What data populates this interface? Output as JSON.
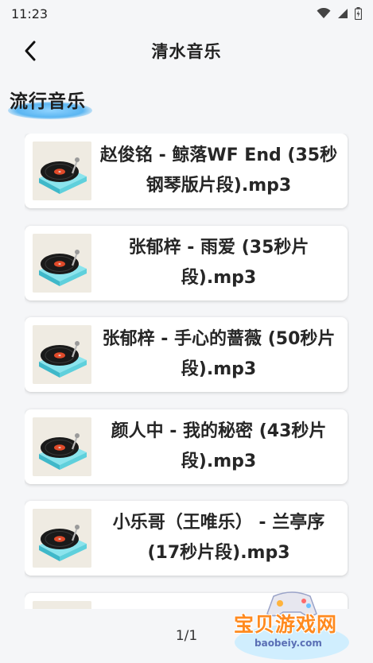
{
  "status_bar": {
    "time": "11:23",
    "icons": [
      "wifi-icon",
      "signal-icon",
      "battery-icon"
    ]
  },
  "header": {
    "title": "清水音乐",
    "back_icon": "chevron-left-icon"
  },
  "section": {
    "heading": "流行音乐"
  },
  "songs": [
    {
      "title": "赵俊铭 - 鲸落WF End (35秒钢琴版片段).mp3"
    },
    {
      "title": "张郁梓 - 雨爱 (35秒片段).mp3"
    },
    {
      "title": "张郁梓 - 手心的蔷薇 (50秒片段).mp3"
    },
    {
      "title": "颜人中 - 我的秘密 (43秒片段).mp3"
    },
    {
      "title": "小乐哥（王唯乐） - 兰亭序 (17秒片段).mp3"
    },
    {
      "title": ""
    }
  ],
  "pager": {
    "text": "1/1"
  },
  "watermark": {
    "main": "宝贝游戏网",
    "sub": "baobeiy.com"
  },
  "colors": {
    "accent": "#5bb6f2",
    "watermark": "#ff8a1f"
  }
}
